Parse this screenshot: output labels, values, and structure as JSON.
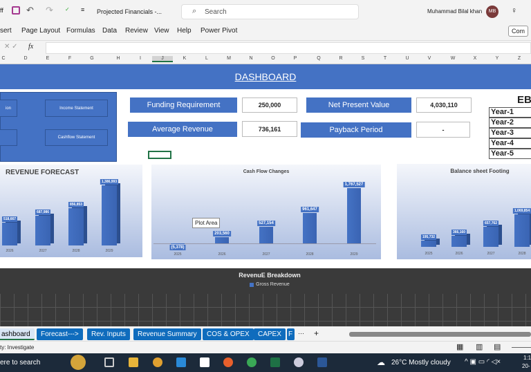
{
  "titlebar": {
    "file_name": "Projected Financials -...",
    "search_placeholder": "Search",
    "user_name": "Muhammad Bilal khan",
    "user_initials": "MB",
    "autosave": "ff"
  },
  "ribbon": {
    "tabs": [
      "sert",
      "Page Layout",
      "Formulas",
      "Data",
      "Review",
      "View",
      "Help",
      "Power Pivot"
    ],
    "comments": "Com"
  },
  "formula_bar": {
    "fx": "fx",
    "value": ""
  },
  "columns": [
    "C",
    "D",
    "E",
    "F",
    "G",
    "H",
    "I",
    "J",
    "K",
    "L",
    "M",
    "N",
    "O",
    "P",
    "Q",
    "R",
    "S",
    "T",
    "U",
    "V",
    "W",
    "X",
    "Y",
    "Z"
  ],
  "dashboard": {
    "title": "DASHBOARD",
    "nav_buttons": [
      "ion",
      "Income Statement",
      "",
      "Cashflow Statement"
    ],
    "kpis": {
      "funding_label": "Funding Requirement",
      "funding_value": "250,000",
      "avg_rev_label": "Average Revenue",
      "avg_rev_value": "736,161",
      "npv_label": "Net Present Value",
      "npv_value": "4,030,110",
      "payback_label": "Payback Period",
      "payback_value": "-"
    },
    "eb_header": "EB",
    "eb_rows": [
      "Year-1",
      "Year-2",
      "Year-3",
      "Year-4",
      "Year-5"
    ],
    "tooltip": "Plot Area",
    "breakdown_title": "RevenuE Breakdown",
    "breakdown_legend": "Gross Revenue"
  },
  "chart_data": [
    {
      "type": "bar",
      "title": "REVENUE FORECAST",
      "categories": [
        "2026",
        "2027",
        "2028",
        "2029"
      ],
      "values": [
        518667,
        687986,
        856853,
        1386993
      ],
      "labels": [
        "518,667",
        "687,986",
        "856,853",
        "1,386,993"
      ],
      "color": "#4472c4"
    },
    {
      "type": "bar",
      "title": "Cash Flow Changes",
      "categories": [
        "2025",
        "2026",
        "2027",
        "2028",
        "2029"
      ],
      "values": [
        -5378,
        203560,
        527154,
        961647,
        1767527
      ],
      "labels": [
        "(5,378)",
        "203,560",
        "527,154",
        "961,647",
        "1,767,527"
      ],
      "color": "#4472c4"
    },
    {
      "type": "bar",
      "title": "Balance sheet Footing",
      "categories": [
        "2025",
        "2026",
        "2027",
        "2028"
      ],
      "values": [
        195732,
        366160,
        657762,
        1069854
      ],
      "labels": [
        "195,732",
        "366,160",
        "657,762",
        "1,069,854"
      ],
      "color": "#4472c4"
    }
  ],
  "sheet_tabs": [
    "ashboard",
    "Forecast--->",
    "Rev. Inputs",
    "Revenue Summary",
    "COS & OPEX",
    "CAPEX",
    "F"
  ],
  "status": {
    "text": "ty: Investigate"
  },
  "taskbar": {
    "search": "ere to search",
    "weather": "26°C  Mostly cloudy",
    "time": "1:1",
    "date": "20-"
  }
}
